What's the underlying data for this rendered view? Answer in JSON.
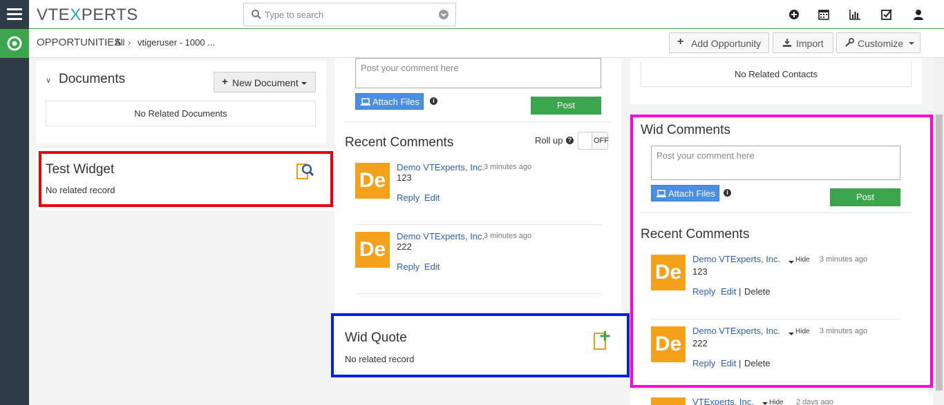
{
  "header": {
    "logo_prefix": "VTE",
    "logo_x": "X",
    "logo_suffix": "PERTS",
    "search_placeholder": "Type to search"
  },
  "breadcrumb": {
    "module": "OPPORTUNITIES",
    "filter": "All",
    "record": "vtigeruser - 1000 ..."
  },
  "actions": {
    "add": "Add Opportunity",
    "import": "Import",
    "customize": "Customize"
  },
  "documents": {
    "title": "Documents",
    "new_button": "New Document",
    "empty": "No Related Documents"
  },
  "test_widget": {
    "title": "Test Widget",
    "empty": "No related record"
  },
  "comments_main": {
    "placeholder": "Post your comment here",
    "attach": "Attach Files",
    "post": "Post",
    "recent_title": "Recent Comments",
    "rollup": "Roll up",
    "toggle": "OFF",
    "items": [
      {
        "avatar": "De",
        "author": "Demo VTExperts, Inc.",
        "time": "3 minutes ago",
        "text": "123",
        "reply": "Reply",
        "edit": "Edit"
      },
      {
        "avatar": "De",
        "author": "Demo VTExperts, Inc.",
        "time": "3 minutes ago",
        "text": "222",
        "reply": "Reply",
        "edit": "Edit"
      }
    ]
  },
  "wid_quote": {
    "title": "Wid Quote",
    "empty": "No related record"
  },
  "contacts": {
    "empty": "No Related Contacts"
  },
  "wid_comments": {
    "title": "Wid Comments",
    "placeholder": "Post your comment here",
    "attach": "Attach Files",
    "post": "Post",
    "recent_title": "Recent Comments",
    "items": [
      {
        "avatar": "De",
        "author": "Demo VTExperts, Inc.",
        "hide": "Hide",
        "time": "3 minutes ago",
        "text": "123",
        "reply": "Reply",
        "edit": "Edit",
        "delete": "Delete"
      },
      {
        "avatar": "De",
        "author": "Demo VTExperts, Inc.",
        "hide": "Hide",
        "time": "3 minutes ago",
        "text": "222",
        "reply": "Reply",
        "edit": "Edit",
        "delete": "Delete"
      }
    ],
    "partial": {
      "author": "VTExperts, Inc.",
      "hide": "Hide",
      "time": "2 days ago"
    }
  },
  "colors": {
    "sidebar": "#2f3c48",
    "accent_green": "#3aa54c",
    "highlight_red": "#e8000b",
    "highlight_blue": "#0022e0",
    "highlight_magenta": "#ff00dd",
    "avatar_orange": "#f4a21b"
  }
}
